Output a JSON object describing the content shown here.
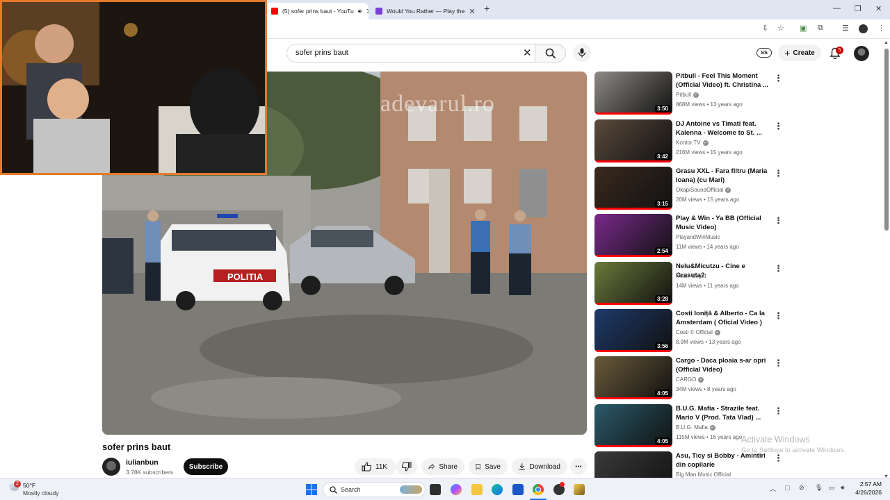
{
  "browser": {
    "tabs": [
      {
        "label": "(5) sofer prins baut - YouTu",
        "active": true
      },
      {
        "label": "Would You Rather — Play the",
        "active": false
      }
    ]
  },
  "youtube": {
    "search_value": "sofer prins baut",
    "ss_badge": "SS",
    "create_label": "Create",
    "notif_count": "5"
  },
  "video": {
    "watermark": "adevarul.ro",
    "title": "sofer prins baut",
    "channel": "iulianbun",
    "subscribers": "3.78K subscribers",
    "subscribe_label": "Subscribe",
    "likes": "11K",
    "share_label": "Share",
    "save_label": "Save",
    "download_label": "Download"
  },
  "recommendations": [
    {
      "title": "Pitbull - Feel This Moment (Official Video) ft. Christina ...",
      "channel": "Pitbull",
      "verified": true,
      "meta": "868M views • 13 years ago",
      "duration": "3:50",
      "color": "#8d8a86"
    },
    {
      "title": "DJ Antoine vs Timati feat. Kalenna - Welcome to St. ...",
      "channel": "Kontor.TV",
      "verified": true,
      "meta": "216M views • 15 years ago",
      "duration": "3:42",
      "color": "#5a4a3c"
    },
    {
      "title": "Grasu XXL - Fara filtru (Maria Ioana) (cu Mari)",
      "channel": "OkapiSoundOfficial",
      "verified": true,
      "meta": "20M views • 15 years ago",
      "duration": "3:15",
      "color": "#3a2a1e"
    },
    {
      "title": "Play & Win - Ya BB (Official Music Video)",
      "channel": "PlayandWinMusic",
      "verified": false,
      "meta": "11M views • 14 years ago",
      "duration": "2:54",
      "color": "#7a2a8c"
    },
    {
      "title": "Nelu&Micutzu - Cine e Grasuta?",
      "channel": "Neam Legat",
      "verified": false,
      "meta": "14M views • 11 years ago",
      "duration": "3:28",
      "color": "#6b7a3a"
    },
    {
      "title": "Costi Ioniță & Alberto - Ca la Amsterdam ( Oficial Video )",
      "channel": "Costi © Official",
      "verified": true,
      "meta": "8.9M views • 13 years ago",
      "duration": "3:56",
      "color": "#1e3a6a"
    },
    {
      "title": "Cargo - Daca ploaia s-ar opri (Official Video)",
      "channel": "CARGO",
      "verified": true,
      "meta": "34M views • 8 years ago",
      "duration": "4:05",
      "color": "#6a5a3a"
    },
    {
      "title": "B.U.G. Mafia - Strazile feat. Mario V (Prod. Tata Vlad) ...",
      "channel": "B.U.G. Mafia",
      "verified": true,
      "meta": "115M views • 16 years ago",
      "duration": "4:05",
      "color": "#2a5a6a"
    },
    {
      "title": "Asu, Ticy si Bobby - Amintiri din copilarie",
      "channel": "Big Man Music Official",
      "verified": false,
      "meta": "",
      "duration": "",
      "color": "#3a3a3a"
    }
  ],
  "watermark_os": {
    "line1": "Activate Windows",
    "line2": "Go to Settings to activate Windows."
  },
  "taskbar": {
    "weather_temp": "50°F",
    "weather_desc": "Mostly cloudy",
    "weather_badge": "2",
    "search_label": "Search",
    "time": "2:57 AM",
    "date": "4/26/2026"
  }
}
